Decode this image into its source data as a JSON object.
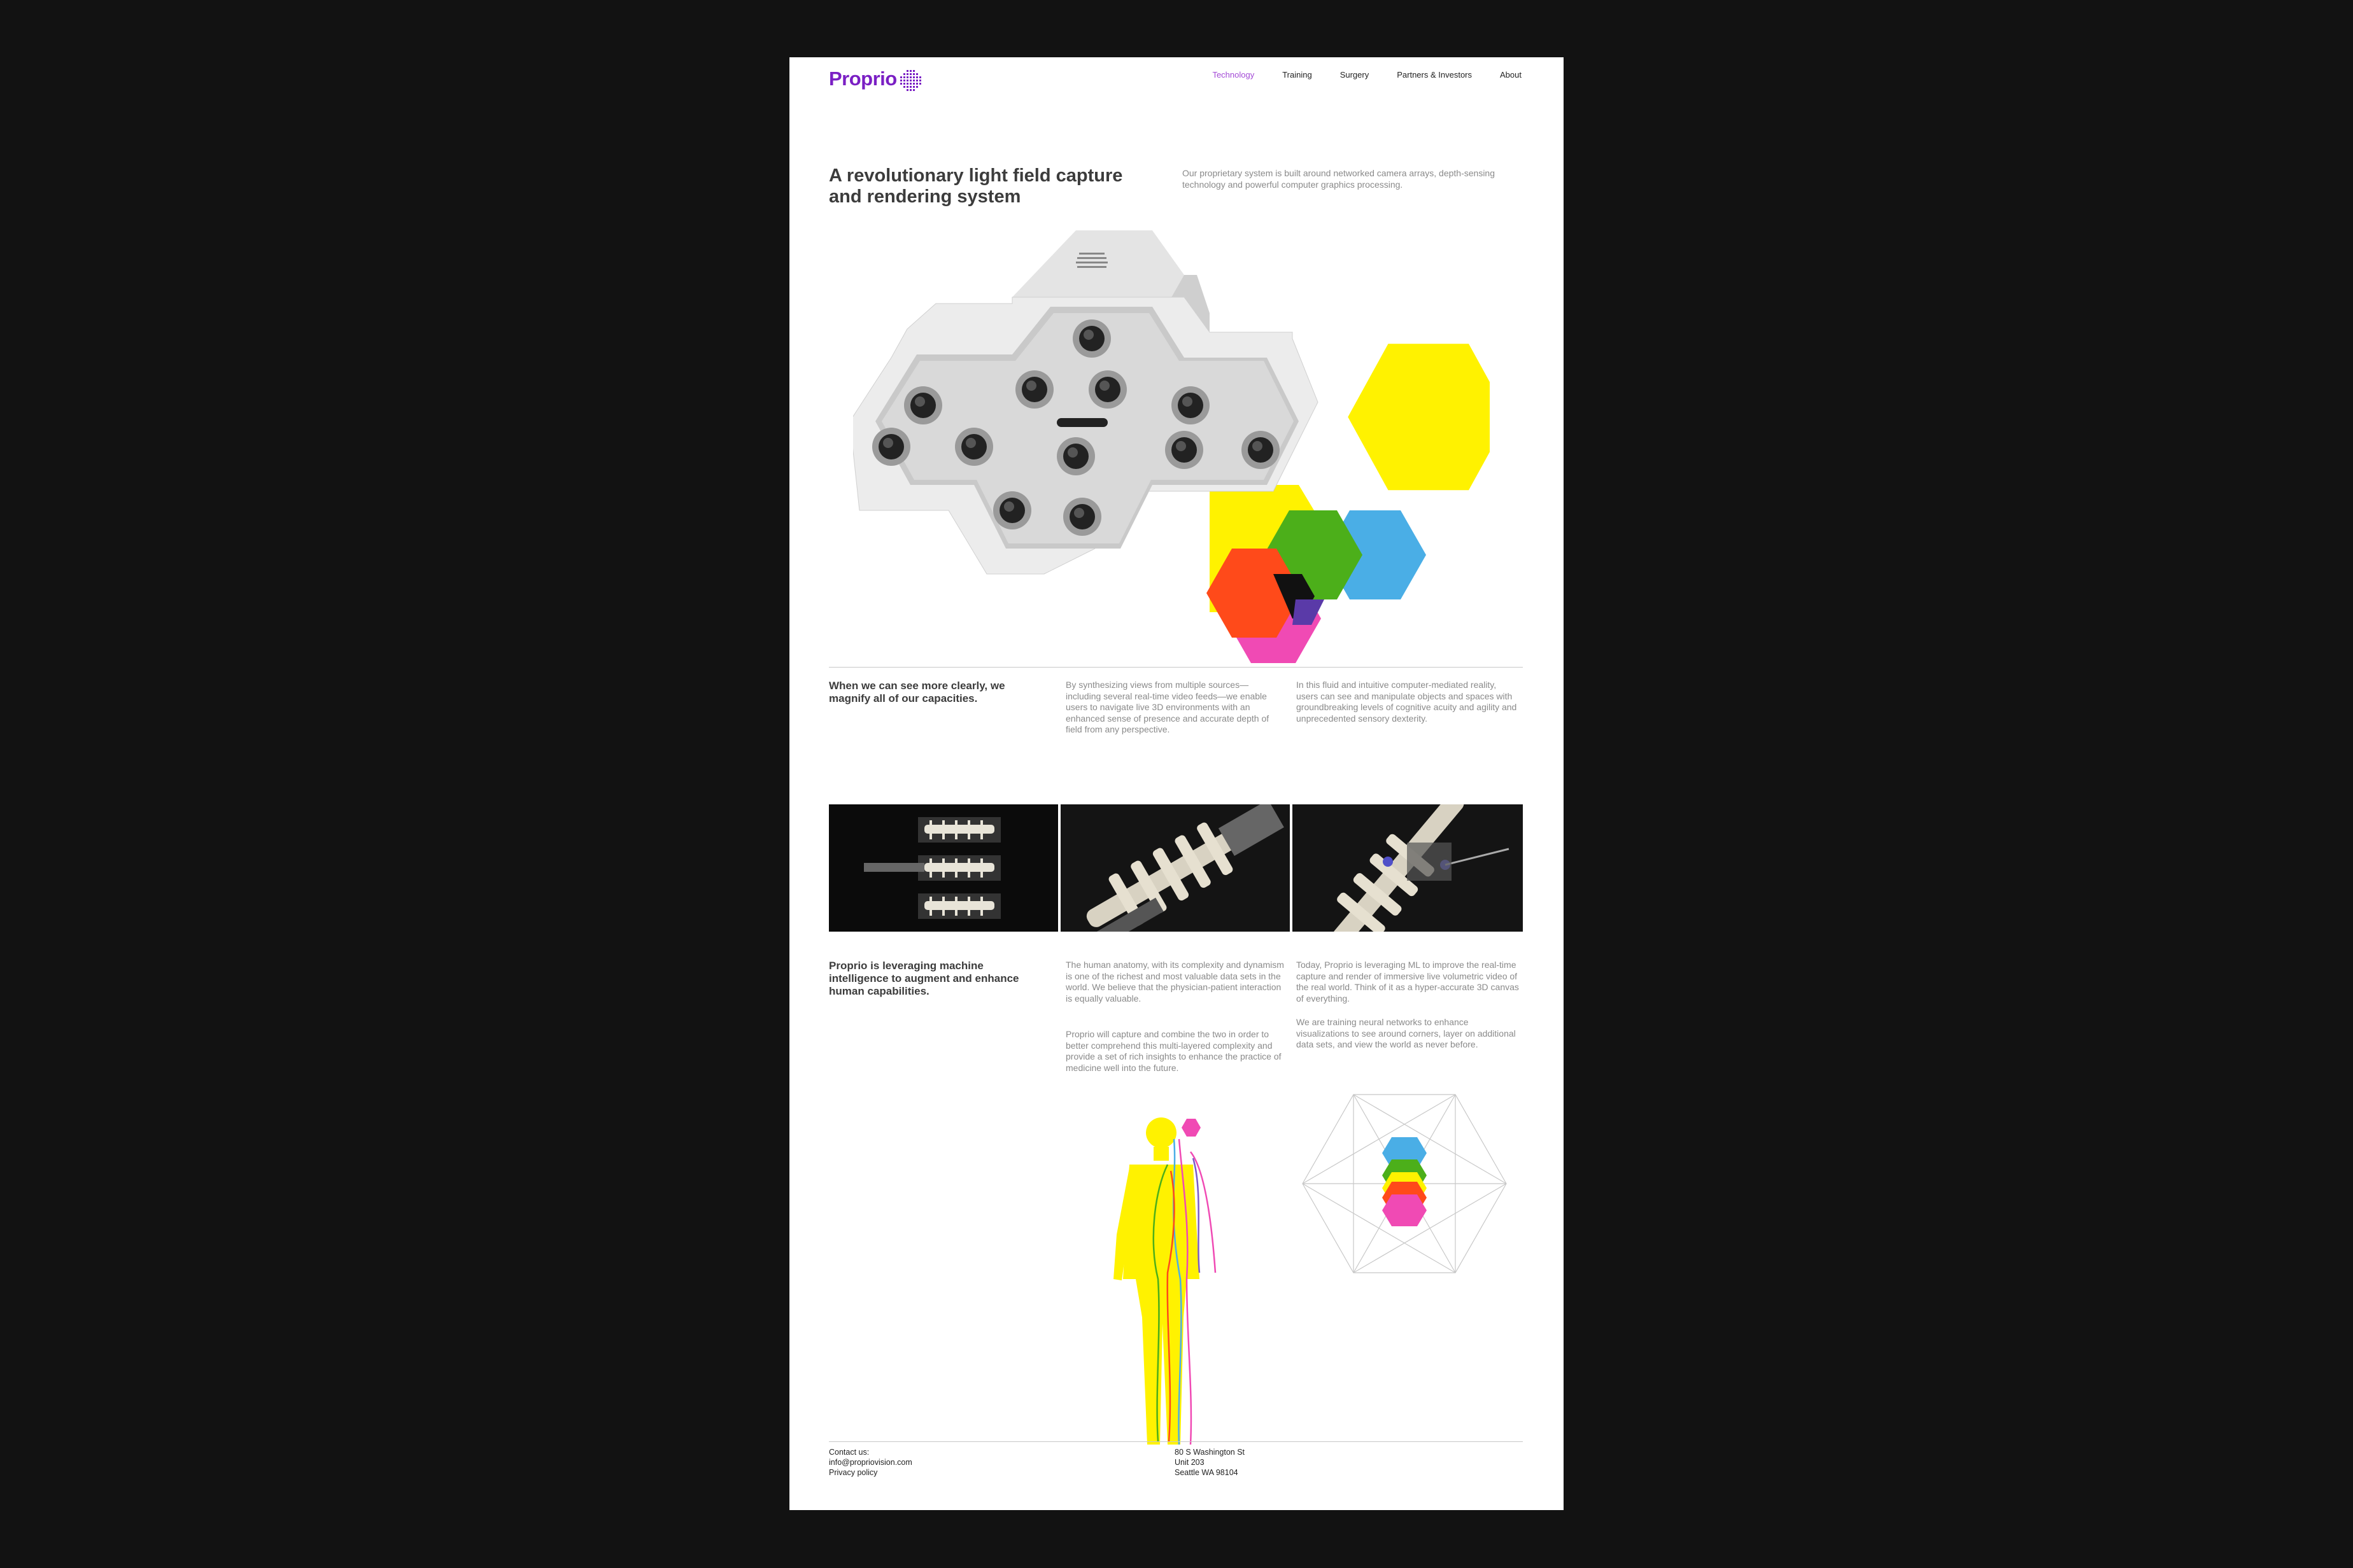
{
  "brand": {
    "name": "Proprio",
    "color": "#7a1fc4"
  },
  "nav": {
    "items": [
      "Technology",
      "Training",
      "Surgery",
      "Partners & Investors",
      "About"
    ],
    "active": "Technology",
    "active_color": "#a34ad6"
  },
  "hero": {
    "title": "A revolutionary light field capture and rendering system",
    "intro": "Our proprietary system is built around networked camera arrays, depth-sensing technology and powerful computer graphics processing."
  },
  "section1": {
    "heading": "When we can see more clearly, we magnify all of our capacities.",
    "col1": "By synthesizing views from multiple sources—including several real-time video feeds—we enable users to navigate live 3D environments with an enhanced sense of presence and accurate depth of field from any perspective.",
    "col2": "In this fluid and intuitive computer-mediated reality, users can see and manipulate objects and spaces with groundbreaking levels of cognitive acuity and agility and unprecedented sensory dexterity."
  },
  "gallery": {
    "images": [
      "spine-grid-render",
      "spine-model-render",
      "spine-surgical-render"
    ]
  },
  "section2": {
    "heading": "Proprio is leveraging machine intelligence to augment and enhance human capabilities.",
    "col1_p1": "The human anatomy, with its complexity and dynamism is one of the richest and most valuable data sets in the world. We believe that the physician-patient interaction is equally valuable.",
    "col1_p2": "Proprio will capture and combine the two in order to better comprehend this multi-layered complexity and provide a set of rich insights to enhance the practice of medicine well into the future.",
    "col2_p1": "Today, Proprio is leveraging ML to improve the real-time capture and render of immersive live volumetric video of the real world. Think of it as a hyper-accurate 3D canvas of everything.",
    "col2_p2": "We are training neural networks to enhance visualizations to see around corners, layer on additional data sets, and view the world as never before."
  },
  "colors": {
    "yellow": "#fff200",
    "green": "#4caf1a",
    "blue": "#4aaee6",
    "red": "#ff4a1a",
    "magenta": "#f04ab4",
    "purple": "#7a1fc4"
  },
  "footer": {
    "contact_label": "Contact us:",
    "email": "info@propriovision.com",
    "privacy": "Privacy policy",
    "address1": "80 S Washington St",
    "address2": "Unit 203",
    "address3": "Seattle WA 98104"
  }
}
